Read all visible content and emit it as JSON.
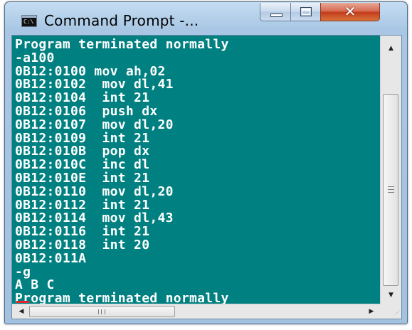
{
  "window": {
    "title": "Command Prompt -...",
    "icon_label": "C:\\",
    "close_glyph": "✕"
  },
  "console": {
    "lines": [
      "Program terminated normally",
      "-a100",
      "0B12:0100 mov ah,02",
      "0B12:0102  mov dl,41",
      "0B12:0104  int 21",
      "0B12:0106  push dx",
      "0B12:0107  mov dl,20",
      "0B12:0109  int 21",
      "0B12:010B  pop dx",
      "0B12:010C  inc dl",
      "0B12:010E  int 21",
      "0B12:0110  mov dl,20",
      "0B12:0112  int 21",
      "0B12:0114  mov dl,43",
      "0B12:0116  int 21",
      "0B12:0118  int 20",
      "0B12:011A",
      "-g",
      "A B C",
      "Program terminated normally",
      "-"
    ],
    "cursor_color": "#e8232e",
    "background": "#008080"
  },
  "scrollbars": {
    "up_icon": "arrow-up-icon",
    "down_icon": "arrow-down-icon",
    "left_icon": "arrow-left-icon",
    "right_icon": "arrow-right-icon",
    "up_glyph": "▲",
    "down_glyph": "▼",
    "left_glyph": "◀",
    "right_glyph": "▶",
    "grip_glyph": "⋰"
  }
}
